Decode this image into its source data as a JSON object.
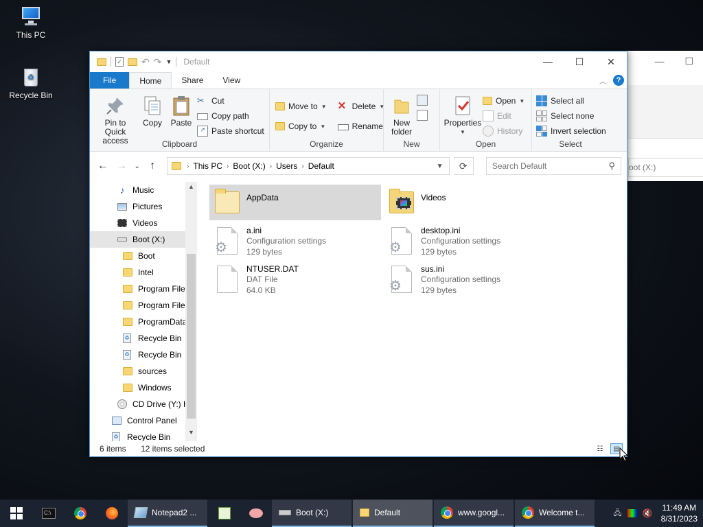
{
  "desktop": {
    "icons": [
      {
        "label": "This PC",
        "icon": "this-pc-icon"
      },
      {
        "label": "Recycle Bin",
        "icon": "recycle-bin-icon"
      }
    ]
  },
  "window": {
    "title": "Default",
    "controls": {
      "minimize": "—",
      "maximize": "☐",
      "close": "✕"
    }
  },
  "tabs": {
    "file": "File",
    "home": "Home",
    "share": "Share",
    "view": "View"
  },
  "ribbon": {
    "clipboard": {
      "label": "Clipboard",
      "pin": "Pin to Quick access",
      "pin_line1": "Pin to Quick",
      "pin_line2": "access",
      "copy": "Copy",
      "paste": "Paste",
      "cut": "Cut",
      "copy_path": "Copy path",
      "paste_shortcut": "Paste shortcut"
    },
    "organize": {
      "label": "Organize",
      "move_to": "Move to",
      "copy_to": "Copy to",
      "delete": "Delete",
      "rename": "Rename"
    },
    "new": {
      "label": "New",
      "new_folder_line1": "New",
      "new_folder_line2": "folder"
    },
    "open": {
      "label": "Open",
      "properties": "Properties",
      "open": "Open",
      "edit": "Edit",
      "history": "History"
    },
    "select": {
      "label": "Select",
      "select_all": "Select all",
      "select_none": "Select none",
      "invert": "Invert selection"
    }
  },
  "address": {
    "crumbs": [
      "This PC",
      "Boot (X:)",
      "Users",
      "Default"
    ],
    "search_placeholder": "Search Default"
  },
  "navpane": {
    "items": [
      {
        "label": "Music",
        "icon": "music-icon",
        "indent": 1
      },
      {
        "label": "Pictures",
        "icon": "pictures-icon",
        "indent": 1
      },
      {
        "label": "Videos",
        "icon": "videos-icon",
        "indent": 1
      },
      {
        "label": "Boot (X:)",
        "icon": "drive-icon",
        "indent": 1
      },
      {
        "label": "Boot",
        "icon": "folder-icon",
        "indent": 2
      },
      {
        "label": "Intel",
        "icon": "folder-icon",
        "indent": 2
      },
      {
        "label": "Program Files",
        "icon": "folder-icon",
        "indent": 2
      },
      {
        "label": "Program Files",
        "icon": "folder-icon",
        "indent": 2
      },
      {
        "label": "ProgramData",
        "icon": "folder-icon",
        "indent": 2
      },
      {
        "label": "Recycle Bin",
        "icon": "recycle-bin-icon",
        "indent": 2
      },
      {
        "label": "Recycle Bin",
        "icon": "recycle-bin-icon",
        "indent": 2
      },
      {
        "label": "sources",
        "icon": "folder-icon",
        "indent": 2
      },
      {
        "label": "Windows",
        "icon": "folder-icon",
        "indent": 2
      },
      {
        "label": "CD Drive (Y:) H",
        "icon": "cd-drive-icon",
        "indent": 1
      },
      {
        "label": "Control Panel",
        "icon": "control-panel-icon",
        "indent": 0
      },
      {
        "label": "Recycle Bin",
        "icon": "recycle-bin-icon",
        "indent": 0
      }
    ]
  },
  "files": [
    {
      "name": "AppData",
      "line1": "",
      "line2": "",
      "type": "folder",
      "selected": true
    },
    {
      "name": "Videos",
      "line1": "",
      "line2": "",
      "type": "video-folder",
      "selected": false
    },
    {
      "name": "a.ini",
      "line1": "Configuration settings",
      "line2": "129 bytes",
      "type": "config",
      "selected": false
    },
    {
      "name": "desktop.ini",
      "line1": "Configuration settings",
      "line2": "129 bytes",
      "type": "config",
      "selected": false
    },
    {
      "name": "NTUSER.DAT",
      "line1": "DAT File",
      "line2": "64.0 KB",
      "type": "file",
      "selected": false
    },
    {
      "name": "sus.ini",
      "line1": "Configuration settings",
      "line2": "129 bytes",
      "type": "config",
      "selected": false
    }
  ],
  "status": {
    "items": "6 items",
    "selected": "12 items selected"
  },
  "background_window": {
    "search_text": "oot (X:)"
  },
  "taskbar": {
    "buttons": [
      {
        "label": "Notepad2 ...",
        "icon": "notepad2-icon"
      },
      {
        "label": "Boot (X:)",
        "icon": "drive-icon"
      },
      {
        "label": "Default",
        "icon": "folder-icon"
      },
      {
        "label": "www.googl...",
        "icon": "chrome-icon"
      },
      {
        "label": "Welcome t...",
        "icon": "chrome-icon"
      }
    ],
    "time": "11:49 AM",
    "date": "8/31/2023"
  },
  "colors": {
    "accent": "#1979ca",
    "selection": "#cce8ff",
    "taskbar": "#1b2230"
  }
}
